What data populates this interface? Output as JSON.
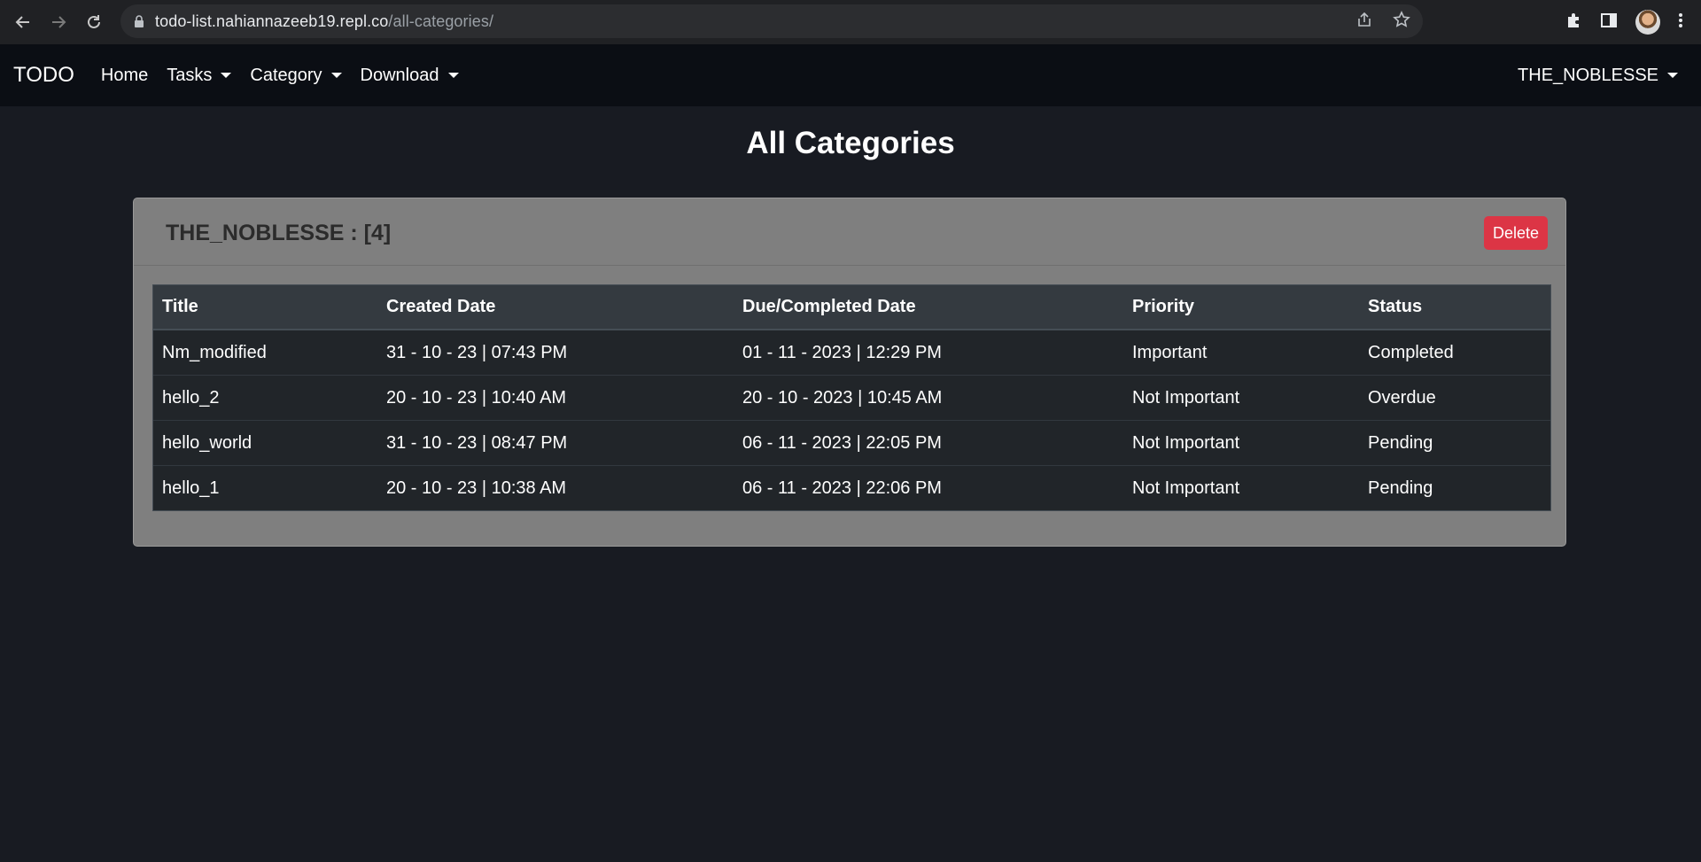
{
  "browser": {
    "url_host": "todo-list.nahiannazeeb19.repl.co",
    "url_path": "/all-categories/"
  },
  "navbar": {
    "brand": "TODO",
    "links": [
      "Home",
      "Tasks",
      "Category",
      "Download"
    ],
    "user": "THE_NOBLESSE"
  },
  "page": {
    "title": "All Categories"
  },
  "category_card": {
    "title": "THE_NOBLESSE : [4]",
    "delete_label": "Delete",
    "table": {
      "headers": [
        "Title",
        "Created Date",
        "Due/Completed Date",
        "Priority",
        "Status"
      ],
      "rows": [
        [
          "Nm_modified",
          "31 - 10 - 23 | 07:43 PM",
          "01 - 11 - 2023 | 12:29 PM",
          "Important",
          "Completed"
        ],
        [
          "hello_2",
          "20 - 10 - 23 | 10:40 AM",
          "20 - 10 - 2023 | 10:45 AM",
          "Not Important",
          "Overdue"
        ],
        [
          "hello_world",
          "31 - 10 - 23 | 08:47 PM",
          "06 - 11 - 2023 | 22:05 PM",
          "Not Important",
          "Pending"
        ],
        [
          "hello_1",
          "20 - 10 - 23 | 10:38 AM",
          "06 - 11 - 2023 | 22:06 PM",
          "Not Important",
          "Pending"
        ]
      ]
    }
  },
  "colors": {
    "delete": "#dc3545",
    "page_bg": "#181b22",
    "card_bg": "#7f7f7f"
  }
}
